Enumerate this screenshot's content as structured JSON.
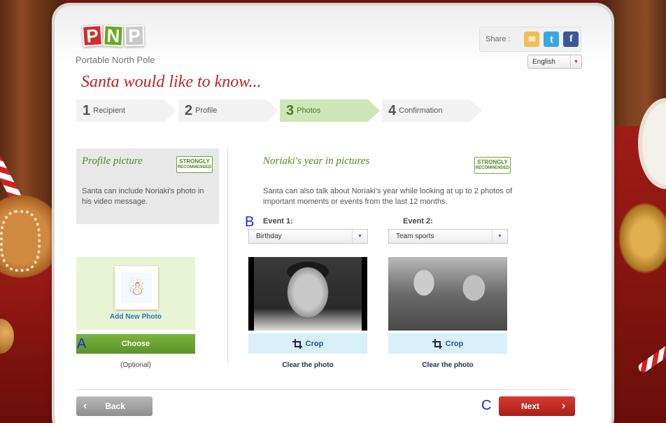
{
  "logo": {
    "tiles": [
      "P",
      "N",
      "P"
    ],
    "subtitle": "Portable North Pole"
  },
  "share": {
    "label": "Share :",
    "twitter_glyph": "t",
    "facebook_glyph": "f"
  },
  "language": {
    "selected": "English"
  },
  "headline": "Santa would like to know...",
  "steps": [
    {
      "num": "1",
      "label": "Recipient",
      "active": false
    },
    {
      "num": "2",
      "label": "Profile",
      "active": false
    },
    {
      "num": "3",
      "label": "Photos",
      "active": true
    },
    {
      "num": "4",
      "label": "Confirmation",
      "active": false
    }
  ],
  "profile": {
    "title": "Profile picture",
    "badge_line1": "STRONGLY",
    "badge_line2": "RECOMMENDED",
    "description": "Santa can include Noriaki's photo in his video message.",
    "add_new_label": "Add New Photo",
    "choose_label": "Choose",
    "optional_label": "(Optional)"
  },
  "year": {
    "title": "Noriaki's year in pictures",
    "badge_line1": "STRONGLY",
    "badge_line2": "RECOMMENDED",
    "description": "Santa can also talk about Noriaki's year while looking at up to 2 photos of important moments or events from the last 12 months.",
    "events": [
      {
        "label": "Event 1:",
        "selected": "Birthday",
        "crop_label": "Crop",
        "clear_label": "Clear the photo"
      },
      {
        "label": "Event 2:",
        "selected": "Team sports",
        "crop_label": "Crop",
        "clear_label": "Clear the photo"
      }
    ]
  },
  "nav": {
    "back_label": "Back",
    "next_label": "Next"
  },
  "annotations": {
    "a": "A",
    "b": "B",
    "c": "C"
  },
  "colors": {
    "headline": "#c42020",
    "accent_green": "#4a8a20",
    "choose_button": "#6aa834",
    "next_button": "#c02c24",
    "back_button": "#a0a0a0",
    "link_blue": "#2277bb"
  }
}
